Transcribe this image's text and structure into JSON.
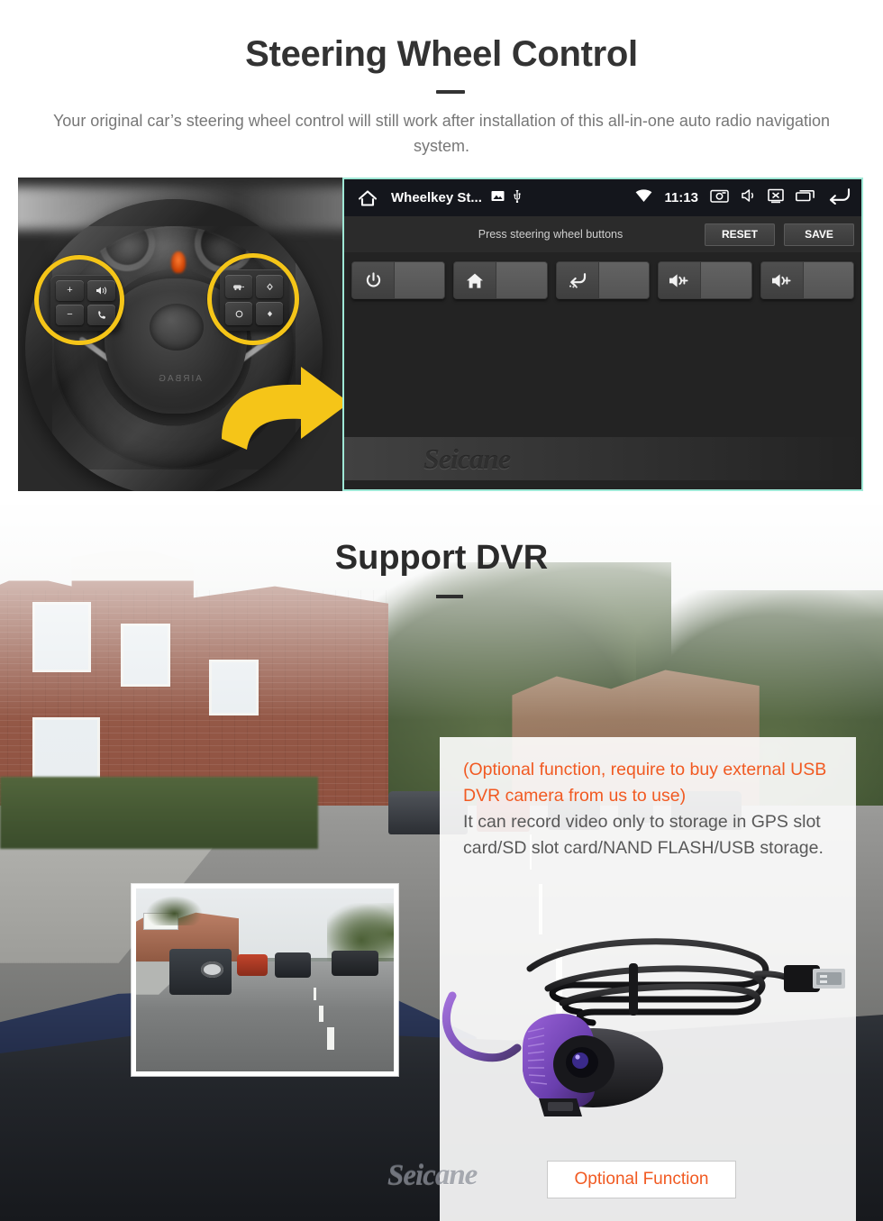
{
  "section_swc": {
    "title": "Steering Wheel Control",
    "subtitle": "Your original car’s steering wheel control will still work after installation of this all-in-one auto radio navigation system.",
    "photo_alt": "steering-wheel-with-highlighted-control-pads",
    "head_unit": {
      "status_bar": {
        "home_icon": "home-icon",
        "app_title": "Wheelkey St...",
        "image_icon": "image-icon",
        "usb_icon": "usb-icon",
        "wifi_icon": "wifi-icon",
        "clock": "11:13",
        "screenshot_icon": "screenshot-camera-icon",
        "mute_icon": "mute-speaker-icon",
        "screen_off_icon": "screen-off-icon",
        "recents_icon": "recent-apps-icon",
        "back_icon": "back-arrow-icon"
      },
      "toolbar": {
        "hint": "Press steering wheel buttons",
        "reset_label": "RESET",
        "save_label": "SAVE"
      },
      "keys": [
        {
          "icon": "power-icon",
          "label": ""
        },
        {
          "icon": "home-icon",
          "label": ""
        },
        {
          "icon": "back-icon",
          "label": ""
        },
        {
          "icon": "volume-up-icon",
          "label": ""
        },
        {
          "icon": "volume-up-icon",
          "label": ""
        }
      ],
      "watermark": "Seicane"
    }
  },
  "section_dvr": {
    "title": "Support DVR",
    "note": "(Optional function, require to buy external USB DVR camera from us to use)",
    "description": "It can record video only to storage in GPS slot card/SD slot card/NAND FLASH/USB storage.",
    "optional_button": "Optional Function",
    "inset_alt": "dashcam-recorded-street-view",
    "product_alt": "usb-dvr-camera-with-cable",
    "watermark": "Seicane"
  },
  "colors": {
    "accent_orange": "#f15a22",
    "highlight_yellow": "#f5c518",
    "title_dark": "#333333",
    "body_gray": "#777777",
    "panel_white": "#ffffff",
    "screen_border_mint": "#9fe8d6"
  }
}
